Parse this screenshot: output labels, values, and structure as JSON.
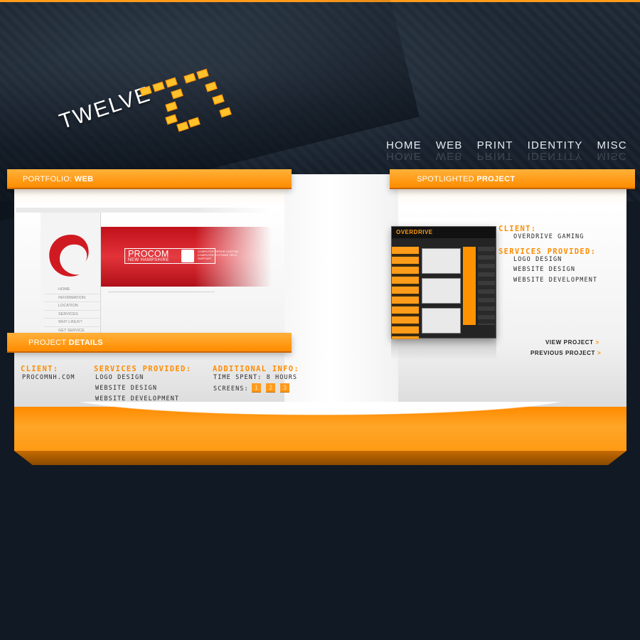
{
  "logo": {
    "word": "TWELVE"
  },
  "nav": [
    {
      "label": "HOME"
    },
    {
      "label": "WEB"
    },
    {
      "label": "PRINT"
    },
    {
      "label": "IDENTITY"
    },
    {
      "label": "MISC"
    }
  ],
  "portfolio_tab": {
    "prefix": "PORTFOLIO: ",
    "strong": "WEB"
  },
  "spotlight_tab": {
    "prefix": "SPOTLIGHTED ",
    "strong": "PROJECT"
  },
  "details_tab": {
    "prefix": "PROJECT ",
    "strong": "DETAILS"
  },
  "preview": {
    "brand": "PROCOM",
    "brand_sub": "NEW HAMPSHIRE",
    "tagline": "COMPUTER REPAIR  CUSTOM COMPUTER SYSTEMS  TECH SUPPORT",
    "menu": [
      "HOME",
      "INFORMATION",
      "LOCATION",
      "SERVICES",
      "WHY LINUX?",
      "GET SERVICE"
    ]
  },
  "details": {
    "client_label": "CLIENT:",
    "client_value": "PROCOMNH.COM",
    "services_label": "SERVICES PROVIDED:",
    "services": [
      "LOGO DESIGN",
      "WEBSITE DESIGN",
      "WEBSITE DEVELOPMENT"
    ],
    "additional_label": "ADDITIONAL INFO:",
    "time_spent": "TIME SPENT: 8 HOURS",
    "screens_label": "SCREENS:",
    "screens": [
      "1",
      "2",
      "3"
    ]
  },
  "spotlight": {
    "preview_logo": "OVERDRIVE",
    "client_label": "CLIENT:",
    "client_value": "OVERDRIVE GAMING",
    "services_label": "SERVICES PROVIDED:",
    "services": [
      "LOGO DESIGN",
      "WEBSITE DESIGN",
      "WEBSITE DEVELOPMENT"
    ],
    "view_project": "VIEW PROJECT",
    "previous_project": "PREVIOUS PROJECT",
    "arrow": ">"
  },
  "colors": {
    "accent": "#ff8c00",
    "background": "#111a24",
    "panel": "#ffffff"
  }
}
